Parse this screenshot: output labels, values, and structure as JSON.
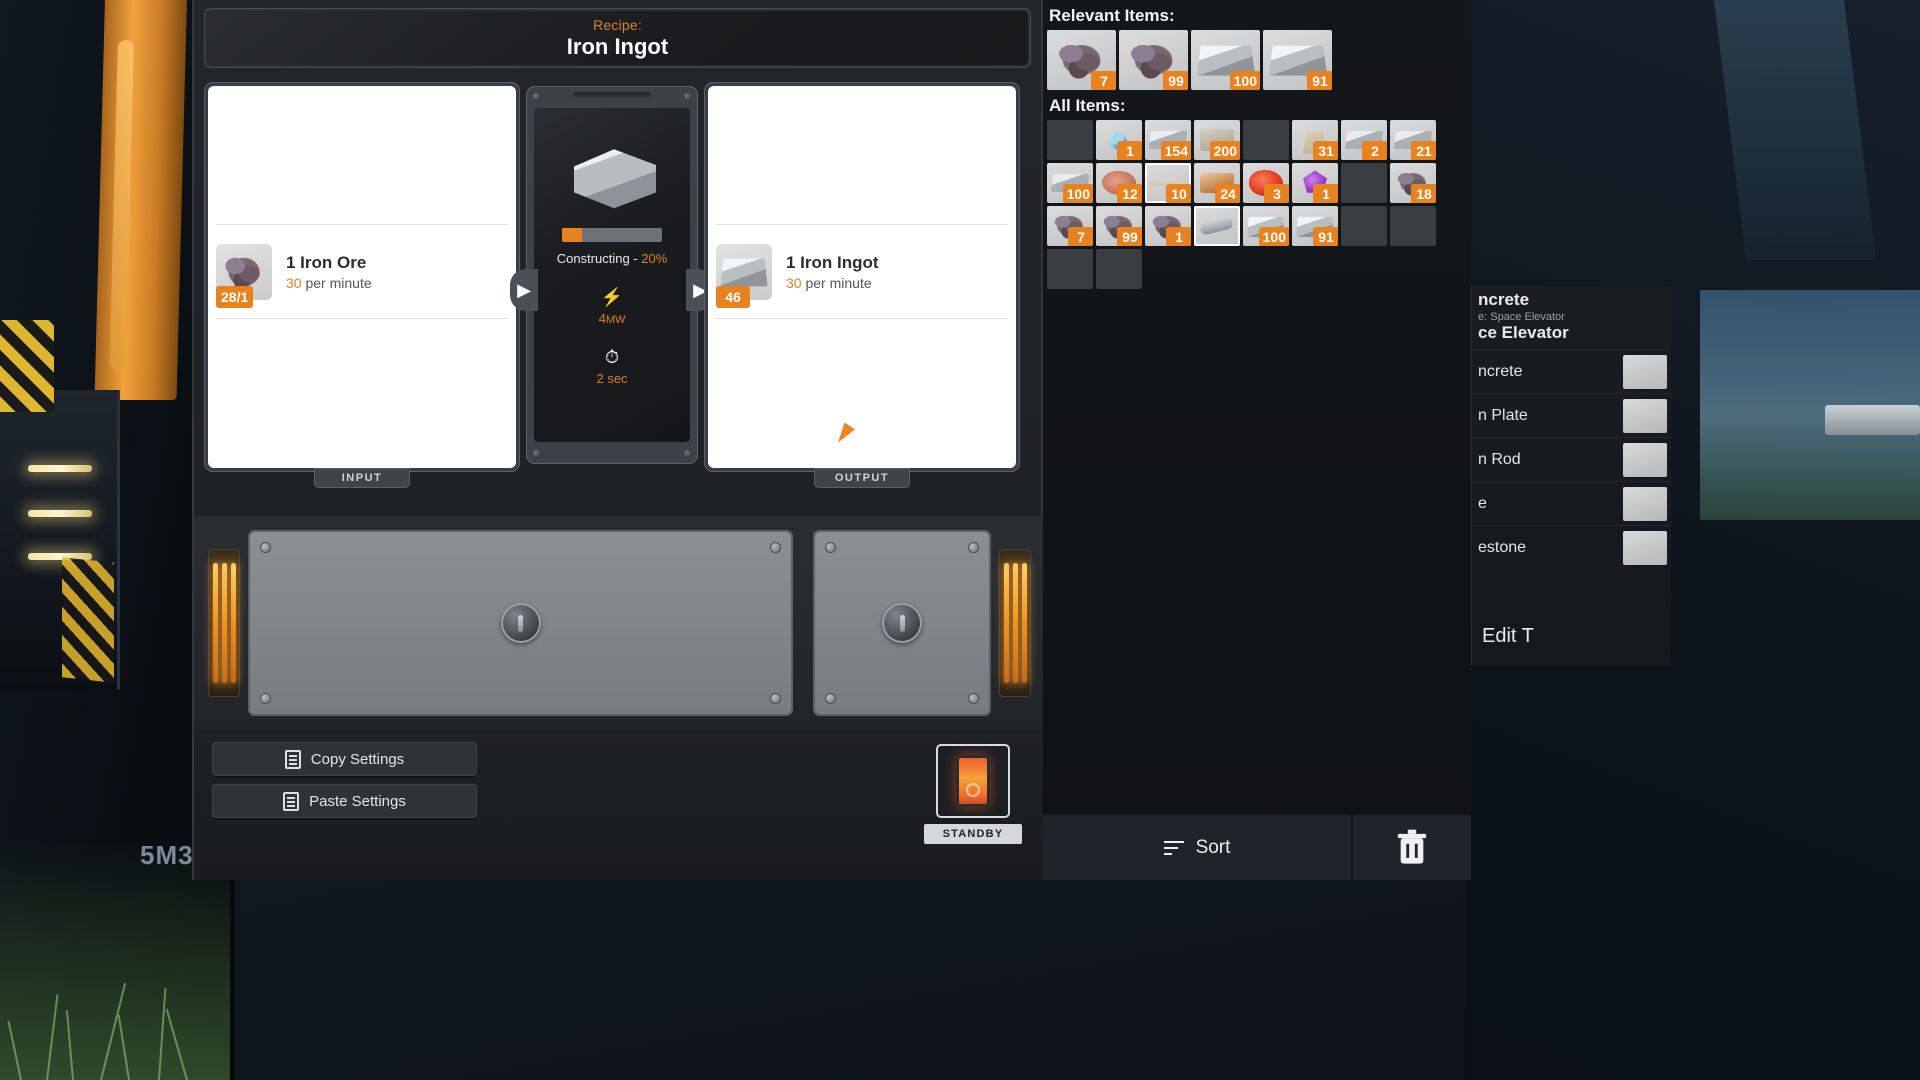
{
  "window": {
    "recipe_label": "Recipe:",
    "recipe_name": "Iron Ingot"
  },
  "input_panel": {
    "tab_label": "INPUT",
    "slot": {
      "count_badge": "28/1",
      "title": "1 Iron Ore",
      "rate_value": "30",
      "rate_unit": "per minute",
      "icon": "iron-ore-icon"
    }
  },
  "output_panel": {
    "tab_label": "OUTPUT",
    "slot": {
      "count_badge": "46",
      "title": "1 Iron Ingot",
      "rate_value": "30",
      "rate_unit": "per minute",
      "icon": "iron-ingot-icon"
    }
  },
  "center_panel": {
    "machine_icon": "smelter-icon",
    "progress_percent": 20,
    "status_text": "Constructing",
    "status_percent": "20%",
    "status_separator": " - ",
    "power_icon": "lightning-bolt-icon",
    "power_value": "4",
    "power_unit": "MW",
    "time_icon": "stopwatch-icon",
    "time_value": "2",
    "time_unit": "sec",
    "prev_arrow": "arrow-left-icon",
    "next_arrow": "arrow-right-icon"
  },
  "footer": {
    "copy_label": "Copy Settings",
    "paste_label": "Paste Settings",
    "copy_icon": "clipboard-copy-icon",
    "paste_icon": "clipboard-paste-icon",
    "standby_label": "STANDBY",
    "standby_switch_icon": "power-switch-icon"
  },
  "inventory": {
    "relevant_heading": "Relevant Items:",
    "all_heading": "All Items:",
    "relevant_items": [
      {
        "icon": "iron-ore-icon",
        "qty": "7"
      },
      {
        "icon": "iron-ore-icon",
        "qty": "99"
      },
      {
        "icon": "iron-ingot-icon",
        "qty": "100"
      },
      {
        "icon": "iron-ingot-icon",
        "qty": "91"
      }
    ],
    "all_items": [
      {
        "icon": "empty-slot",
        "qty": "",
        "empty": true
      },
      {
        "icon": "crystal-icon",
        "qty": "1"
      },
      {
        "icon": "iron-plate-icon",
        "qty": "154"
      },
      {
        "icon": "concrete-icon",
        "qty": "200"
      },
      {
        "icon": "empty-slot",
        "qty": "",
        "empty": true
      },
      {
        "icon": "bag-icon",
        "qty": "31"
      },
      {
        "icon": "iron-plate-icon",
        "qty": "2"
      },
      {
        "icon": "iron-plate-icon",
        "qty": "21"
      },
      {
        "icon": "iron-plate-icon",
        "qty": "100"
      },
      {
        "icon": "meat-icon",
        "qty": "12"
      },
      {
        "icon": "tool-icon",
        "qty": "10",
        "highlight": true
      },
      {
        "icon": "copper-ingot-icon",
        "qty": "24"
      },
      {
        "icon": "red-crystal-icon",
        "qty": "3"
      },
      {
        "icon": "purple-gem-icon",
        "qty": "1"
      },
      {
        "icon": "empty-slot",
        "qty": "",
        "empty": true
      },
      {
        "icon": "iron-ore-icon",
        "qty": "18"
      },
      {
        "icon": "iron-ore-icon",
        "qty": "7"
      },
      {
        "icon": "iron-ore-icon",
        "qty": "99"
      },
      {
        "icon": "iron-ore-icon",
        "qty": "1"
      },
      {
        "icon": "rod-icon",
        "qty": "",
        "highlight": true
      },
      {
        "icon": "iron-ingot-icon",
        "qty": "100"
      },
      {
        "icon": "iron-ingot-icon",
        "qty": "91"
      },
      {
        "icon": "empty-slot",
        "qty": "",
        "empty": true
      },
      {
        "icon": "empty-slot",
        "qty": "",
        "empty": true
      },
      {
        "icon": "empty-slot",
        "qty": "",
        "empty": true
      },
      {
        "icon": "empty-slot",
        "qty": "",
        "empty": true
      }
    ],
    "sort_label": "Sort",
    "sort_icon": "sort-icon",
    "trash_icon": "trash-icon"
  },
  "build_menu": {
    "title": "ncrete",
    "subtitle": "e: Space Elevator",
    "subtitle2": "ce Elevator",
    "items": [
      {
        "label": "ncrete"
      },
      {
        "label": "n Plate"
      },
      {
        "label": "n Rod"
      },
      {
        "label": "e"
      },
      {
        "label": "estone"
      }
    ],
    "edit_label": "Edit T"
  },
  "world": {
    "marker_text": "5M3"
  },
  "colors": {
    "accent_orange": "#e8821e",
    "recipe_orange": "#d9822b",
    "panel_dark": "#1c1f23",
    "panel_mid": "#3a3e44",
    "slot_white": "#ffffff"
  }
}
